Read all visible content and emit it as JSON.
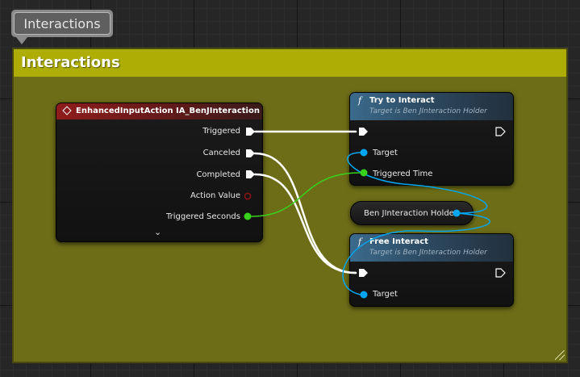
{
  "bubble": {
    "label": "Interactions"
  },
  "comment": {
    "title": "Interactions"
  },
  "event_node": {
    "title": "EnhancedInputAction IA_BenJInteraction",
    "outputs": [
      "Triggered",
      "Canceled",
      "Completed",
      "Action Value",
      "Triggered Seconds"
    ]
  },
  "try_node": {
    "title": "Try to Interact",
    "subtitle": "Target is Ben JInteraction Holder",
    "target_label": "Target",
    "triggered_time_label": "Triggered Time"
  },
  "var_node": {
    "label": "Ben JInteraction Holder"
  },
  "free_node": {
    "title": "Free Interact",
    "subtitle": "Target is Ben JInteraction Holder",
    "target_label": "Target"
  },
  "colors": {
    "exec": "#ffffff",
    "float_pin": "#38d11c",
    "object_pin": "#00a7f0",
    "struct_pin": "#8c1616",
    "comment_header": "#adad05",
    "comment_body": "#6d6d18",
    "event_header": "#8f1c1c",
    "function_header": "#3b6b8c"
  },
  "icons": {
    "function": "f",
    "event": "diamond-icon",
    "expand": "chevron-down-icon"
  }
}
